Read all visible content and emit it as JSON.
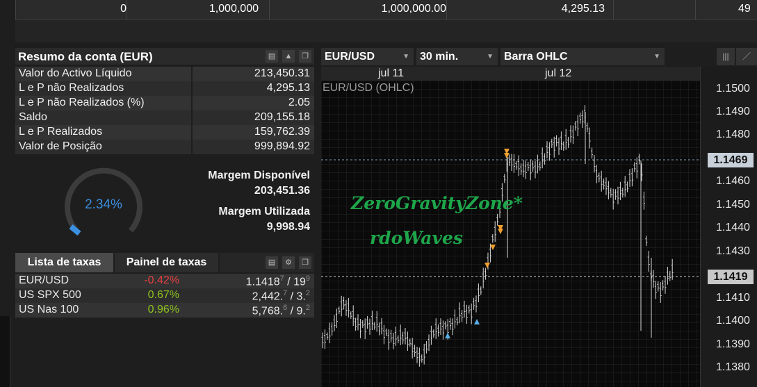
{
  "top_table": {
    "cells": [
      "0",
      "1,000,000",
      "1,000,000.00",
      "4,295.13",
      "49"
    ]
  },
  "account": {
    "title": "Resumo da conta (EUR)",
    "rows": [
      {
        "label": "Valor do Activo Líquido",
        "value": "213,450.31"
      },
      {
        "label": "L e P não Realizados",
        "value": "4,295.13"
      },
      {
        "label": "L e P não Realizados (%)",
        "value": "2.05"
      },
      {
        "label": "Saldo",
        "value": "209,155.18"
      },
      {
        "label": "L e P Realizados",
        "value": "159,762.39"
      },
      {
        "label": "Valor de Posição",
        "value": "999,894.92"
      }
    ],
    "gauge_text": "2.34%",
    "gauge_level": 0.0234,
    "available_label": "Margem Disponível",
    "available_value": "203,451.36",
    "used_label": "Margem Utilizada",
    "used_value": "9,998.94"
  },
  "rates": {
    "tabs": [
      "Lista de taxas",
      "Painel de taxas"
    ],
    "rows": [
      {
        "name": "EUR/USD",
        "change": "-0.42%",
        "change_color": "#e84040",
        "price": "1.1418",
        "price_sup": "7",
        "price_tail": " / 19",
        "price_tail_sup": "9"
      },
      {
        "name": "US SPX 500",
        "change": "0.67%",
        "change_color": "#8fc31f",
        "price": "2,442.",
        "price_sup": "7",
        "price_tail": " / 3.",
        "price_tail_sup": "2"
      },
      {
        "name": "US Nas 100",
        "change": "0.96%",
        "change_color": "#8fc31f",
        "price": "5,768.",
        "price_sup": "6",
        "price_tail": " / 9.",
        "price_tail_sup": "2"
      }
    ]
  },
  "chart": {
    "symbol": "EUR/USD",
    "timeframe": "30 min.",
    "chart_type": "Barra OHLC",
    "series_label": "EUR/USD (OHLC)",
    "date_labels": [
      "jul 11",
      "jul 12"
    ],
    "price_ticks": [
      "1.1500",
      "1.1490",
      "1.1480",
      "1.1460",
      "1.1450",
      "1.1440",
      "1.1430",
      "1.1410",
      "1.1400",
      "1.1390",
      "1.1380"
    ],
    "price_marker_1": "1.1469",
    "price_marker_2": "1.1419",
    "watermark_line1": "ZeroGravityZone*",
    "watermark_line2": "rdoWaves"
  },
  "colors": {
    "negative": "#e84040",
    "positive": "#8fc31f",
    "gauge": "#3a8fe0",
    "watermark": "#1ea64a",
    "sell_arrow": "#f0a030",
    "buy_arrow": "#5aaee8"
  }
}
